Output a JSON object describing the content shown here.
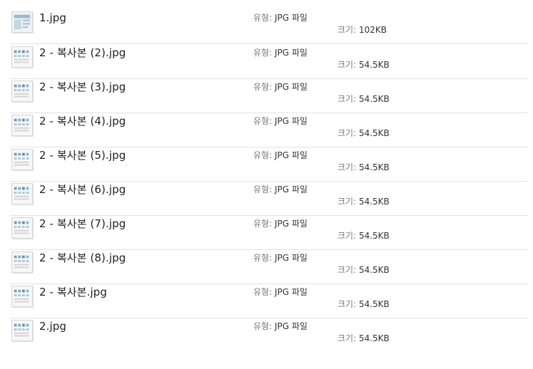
{
  "labels": {
    "type_label": "유형",
    "size_label": "크기",
    "colon": ": "
  },
  "files": [
    {
      "name": "1.jpg",
      "type": "JPG 파일",
      "size": "102KB",
      "thumbnail": "image-thumbnail-icon"
    },
    {
      "name": "2 - 복사본 (2).jpg",
      "type": "JPG 파일",
      "size": "54.5KB",
      "thumbnail": "image-thumbnail-icon"
    },
    {
      "name": "2 - 복사본 (3).jpg",
      "type": "JPG 파일",
      "size": "54.5KB",
      "thumbnail": "image-thumbnail-icon"
    },
    {
      "name": "2 - 복사본 (4).jpg",
      "type": "JPG 파일",
      "size": "54.5KB",
      "thumbnail": "image-thumbnail-icon"
    },
    {
      "name": "2 - 복사본 (5).jpg",
      "type": "JPG 파일",
      "size": "54.5KB",
      "thumbnail": "image-thumbnail-icon"
    },
    {
      "name": "2 - 복사본 (6).jpg",
      "type": "JPG 파일",
      "size": "54.5KB",
      "thumbnail": "image-thumbnail-icon"
    },
    {
      "name": "2 - 복사본 (7).jpg",
      "type": "JPG 파일",
      "size": "54.5KB",
      "thumbnail": "image-thumbnail-icon"
    },
    {
      "name": "2 - 복사본 (8).jpg",
      "type": "JPG 파일",
      "size": "54.5KB",
      "thumbnail": "image-thumbnail-icon"
    },
    {
      "name": "2 - 복사본.jpg",
      "type": "JPG 파일",
      "size": "54.5KB",
      "thumbnail": "image-thumbnail-icon"
    },
    {
      "name": "2.jpg",
      "type": "JPG 파일",
      "size": "54.5KB",
      "thumbnail": "image-thumbnail-icon"
    }
  ]
}
